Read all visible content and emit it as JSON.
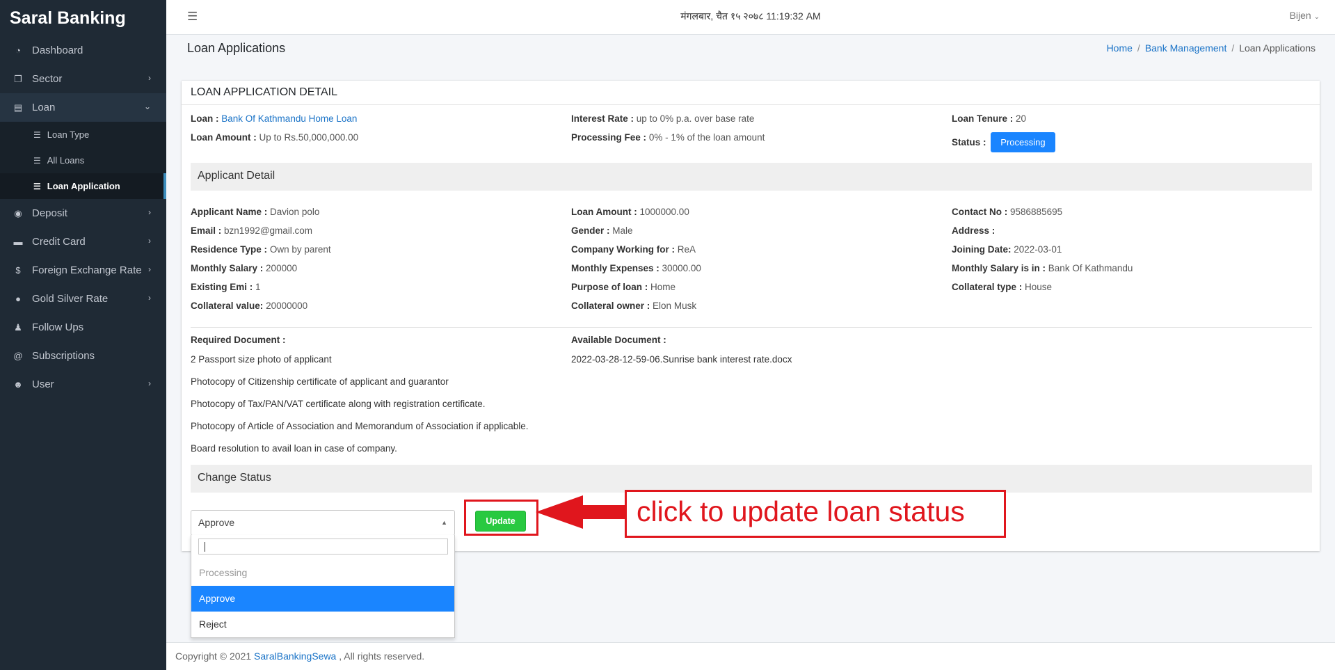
{
  "sidebar": {
    "brand": "Saral Banking",
    "items": [
      {
        "label": "Dashboard",
        "icon": "dashboard-icon"
      },
      {
        "label": "Sector",
        "icon": "copy-icon"
      },
      {
        "label": "Loan",
        "icon": "money-icon"
      },
      {
        "label": "Deposit",
        "icon": "piggy-bank-icon"
      },
      {
        "label": "Credit Card",
        "icon": "credit-card-icon"
      },
      {
        "label": "Foreign Exchange Rate",
        "icon": "dollar-icon"
      },
      {
        "label": "Gold Silver Rate",
        "icon": "hand-coin-icon"
      },
      {
        "label": "Follow Ups",
        "icon": "user-plus-icon"
      },
      {
        "label": "Subscriptions",
        "icon": "at-icon"
      },
      {
        "label": "User",
        "icon": "users-icon"
      }
    ],
    "loan_sub": [
      {
        "label": "Loan Type"
      },
      {
        "label": "All Loans"
      },
      {
        "label": "Loan Application"
      }
    ]
  },
  "topbar": {
    "datetime": "मंगलबार, चैत १५ २०७८ 11:19:32 AM",
    "user": "Bijen"
  },
  "header": {
    "title": "Loan Applications",
    "breadcrumb": [
      "Home",
      "Bank Management",
      "Loan Applications"
    ]
  },
  "card": {
    "title": "LOAN APPLICATION DETAIL",
    "loan": {
      "loan_label": "Loan :",
      "loan_value": "Bank Of Kathmandu Home Loan",
      "amount_label": "Loan Amount :",
      "amount_value": "Up to Rs.50,000,000.00",
      "interest_label": "Interest Rate :",
      "interest_value": "up to 0% p.a. over base rate",
      "fee_label": "Processing Fee :",
      "fee_value": "0% - 1% of the loan amount",
      "tenure_label": "Loan Tenure :",
      "tenure_value": "20",
      "status_label": "Status :",
      "status_value": "Processing"
    },
    "applicant_section": "Applicant Detail",
    "applicant": {
      "name_label": "Applicant Name :",
      "name_value": "Davion polo",
      "email_label": "Email :",
      "email_value": "bzn1992@gmail.com",
      "residence_label": "Residence Type :",
      "residence_value": "Own by parent",
      "salary_label": "Monthly Salary :",
      "salary_value": "200000",
      "emi_label": "Existing Emi :",
      "emi_value": "1",
      "collateral_label": "Collateral value:",
      "collateral_value": "20000000",
      "loan_amount_label": "Loan Amount :",
      "loan_amount_value": "1000000.00",
      "gender_label": "Gender :",
      "gender_value": "Male",
      "company_label": "Company Working for :",
      "company_value": "ReA",
      "expenses_label": "Monthly Expenses :",
      "expenses_value": "30000.00",
      "purpose_label": "Purpose of loan :",
      "purpose_value": "Home",
      "owner_label": "Collateral owner :",
      "owner_value": "Elon Musk",
      "contact_label": "Contact No :",
      "contact_value": "9586885695",
      "address_label": "Address :",
      "address_value": "",
      "joining_label": "Joining Date:",
      "joining_value": "2022-03-01",
      "salary_in_label": "Monthly Salary is in :",
      "salary_in_value": "Bank Of Kathmandu",
      "ctype_label": "Collateral type :",
      "ctype_value": "House"
    },
    "documents": {
      "required_label": "Required Document :",
      "required": [
        "2 Passport size photo of applicant",
        "Photocopy of Citizenship certificate of applicant and guarantor",
        "Photocopy of Tax/PAN/VAT certificate along with registration certificate.",
        "Photocopy of Article of Association and Memorandum of Association if applicable.",
        "Board resolution to avail loan in case of company."
      ],
      "available_label": "Available Document :",
      "available_file": "2022-03-28-12-59-06.Sunrise bank interest rate.docx"
    },
    "change_status_section": "Change Status",
    "status_select": {
      "selected": "Approve",
      "search_value": "",
      "options": [
        "Processing",
        "Approve",
        "Reject"
      ]
    },
    "update_label": "Update"
  },
  "annotation": {
    "text": "click to update loan status",
    "color": "#e0161d"
  },
  "footer": {
    "prefix": "Copyright © 2021",
    "link": "SaralBankingSewa",
    "suffix": ", All rights reserved."
  }
}
